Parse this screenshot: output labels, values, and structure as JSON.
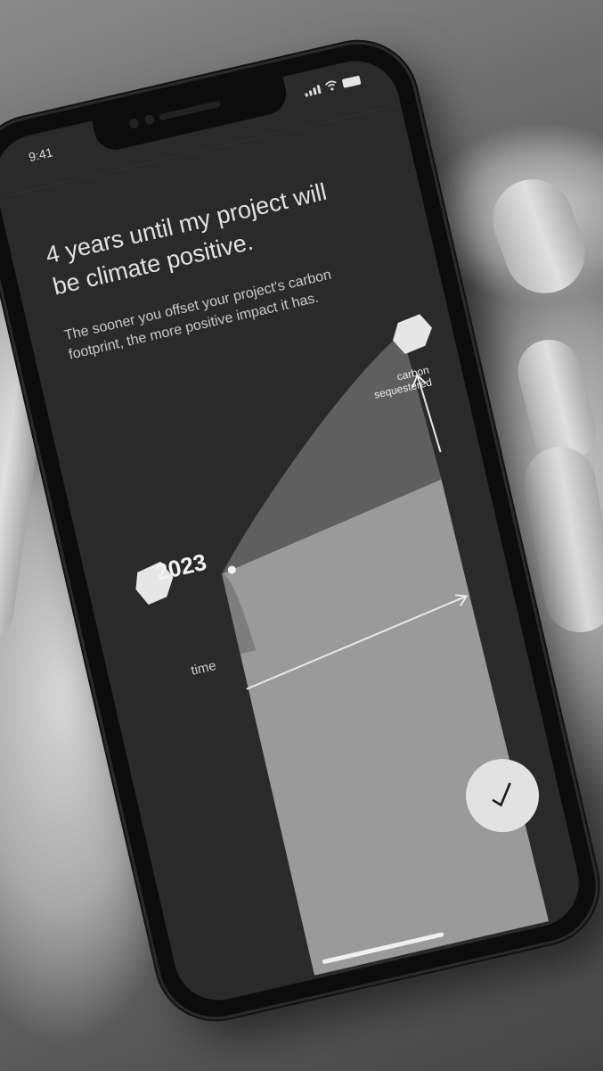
{
  "status_bar": {
    "time": "9:41"
  },
  "headline": "4 years until my project will be climate positive.",
  "subtext": "The sooner you offset your project's carbon footprint, the more positive impact it has.",
  "chart": {
    "year": "2023",
    "y_axis_label": "carbon sequestered",
    "x_axis_label": "time"
  },
  "confirm_button": {
    "icon": "checkmark-icon"
  },
  "colors": {
    "screen_background": "#2a2a2a",
    "curve_fill": "#5f5f5f",
    "panel_fill": "#9a9a9a",
    "button_fill": "#e2e2e2"
  }
}
